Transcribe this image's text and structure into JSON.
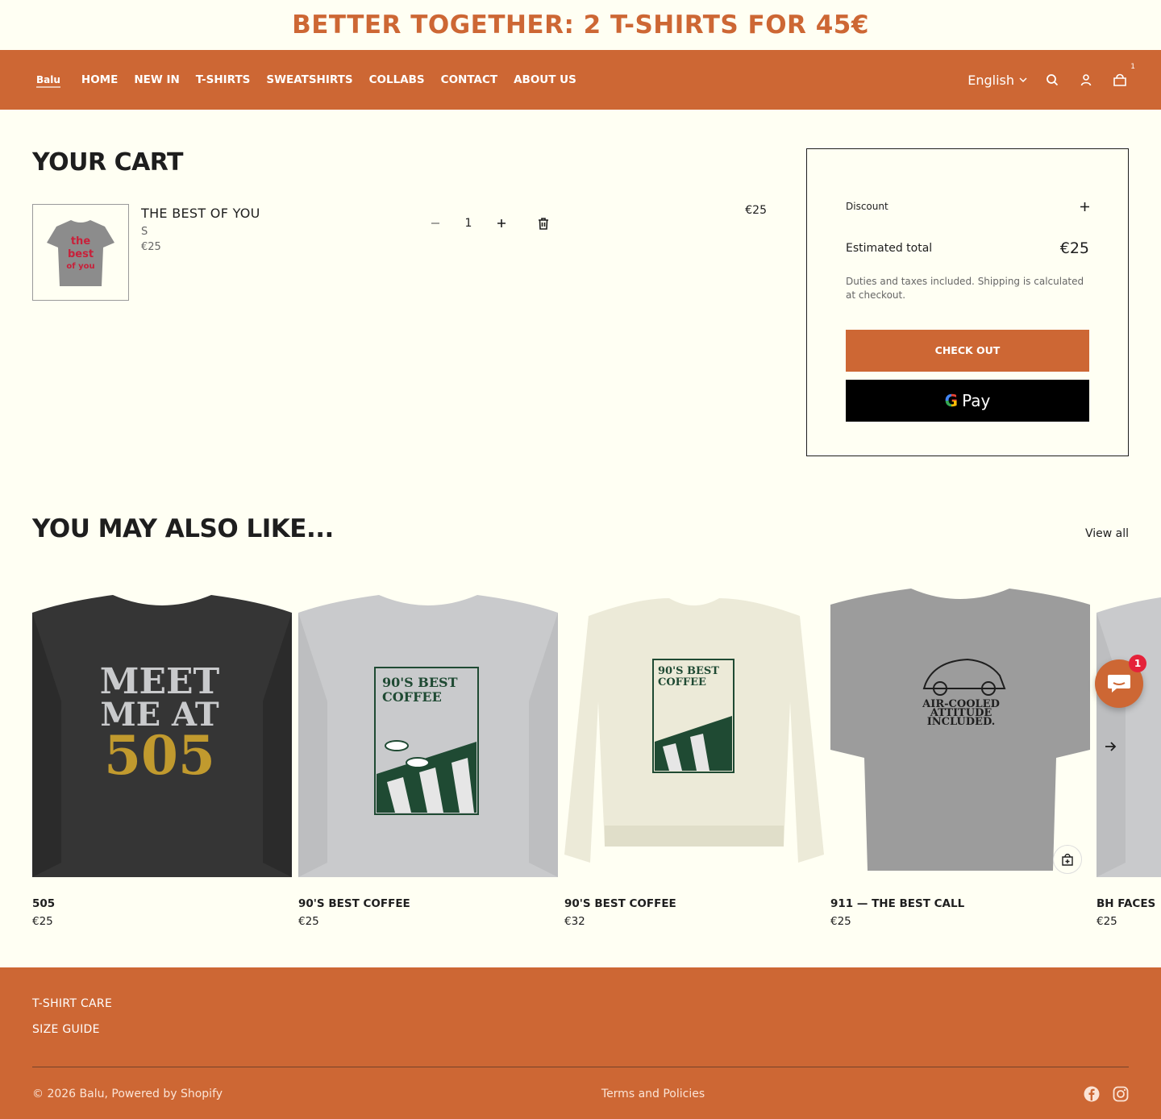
{
  "promo": {
    "text": "BETTER TOGETHER: 2 T-SHIRTS FOR 45€"
  },
  "header": {
    "logo": "Balu",
    "nav": [
      "HOME",
      "NEW IN",
      "T-SHIRTS",
      "SWEATSHIRTS",
      "COLLABS",
      "CONTACT",
      "ABOUT US"
    ],
    "language": "English",
    "cart_count": "1",
    "icons": [
      "search-icon",
      "account-icon",
      "cart-icon"
    ]
  },
  "cart": {
    "title": "YOUR CART",
    "item": {
      "name": "THE BEST OF YOU",
      "variant": "S",
      "unit_price": "€25",
      "quantity": "1",
      "line_total": "€25",
      "image_text": [
        "the",
        "best",
        "of you"
      ]
    }
  },
  "summary": {
    "discount_label": "Discount",
    "total_label": "Estimated total",
    "total_value": "€25",
    "tax_note": "Duties and taxes included. Shipping is calculated at checkout.",
    "checkout_label": "CHECK OUT",
    "gpay_label": "Pay"
  },
  "recommendations": {
    "title": "YOU MAY ALSO LIKE...",
    "view_all": "View all",
    "products": [
      {
        "name": "505",
        "price": "€25",
        "image_text": [
          "MEET",
          "ME AT",
          "505"
        ],
        "color": "#353535"
      },
      {
        "name": "90'S BEST COFFEE",
        "price": "€25",
        "image_text": [
          "90'S BEST",
          "COFFEE"
        ],
        "color": "#c9cacc"
      },
      {
        "name": "90'S BEST COFFEE",
        "price": "€32",
        "image_text": [
          "90'S BEST",
          "COFFEE"
        ],
        "color": "#ecead8"
      },
      {
        "name": "911 — THE BEST CALL",
        "price": "€25",
        "image_text": [
          "AIR-COOLED",
          "ATTITUDE",
          "INCLUDED."
        ],
        "color": "#9c9c9c"
      },
      {
        "name": "BH FACES",
        "price": "€25",
        "color": "#c9cacc"
      }
    ]
  },
  "chat": {
    "badge": "1"
  },
  "footer": {
    "links": [
      "T-SHIRT CARE",
      "SIZE GUIDE"
    ],
    "copyright": "© 2026 Balu, Powered by Shopify",
    "policies": "Terms and Policies",
    "socials": [
      "facebook-icon",
      "instagram-icon"
    ]
  },
  "colors": {
    "brand": "#cd6734",
    "background": "#fffff3",
    "text": "#1e1e1e"
  }
}
